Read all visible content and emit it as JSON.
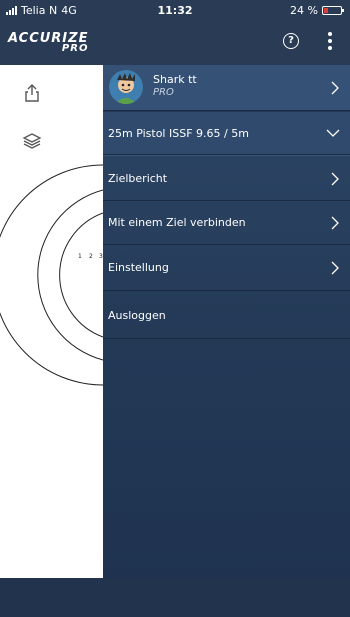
{
  "status": {
    "carrier": "Telia N",
    "network": "4G",
    "time": "11:32",
    "battery_text": "24 %",
    "battery_level": 0.24
  },
  "header": {
    "logo_line1": "ACCURIZE",
    "logo_line2": "PRO",
    "help_symbol": "?"
  },
  "sidebar": {
    "target_rings": [
      "1",
      "2",
      "3"
    ]
  },
  "drawer": {
    "profile": {
      "name": "Shark tt",
      "tier": "PRO"
    },
    "mode": {
      "label": "25m Pistol ISSF 9.65 / 5m"
    },
    "items": [
      {
        "label": "Zielbericht"
      },
      {
        "label": "Mit einem Ziel verbinden"
      },
      {
        "label": "Einstellung"
      },
      {
        "label": "Ausloggen"
      }
    ]
  },
  "colors": {
    "drawer": "#2a4264",
    "topbar": "#2a3b55",
    "sidebar": "#ffffff"
  }
}
